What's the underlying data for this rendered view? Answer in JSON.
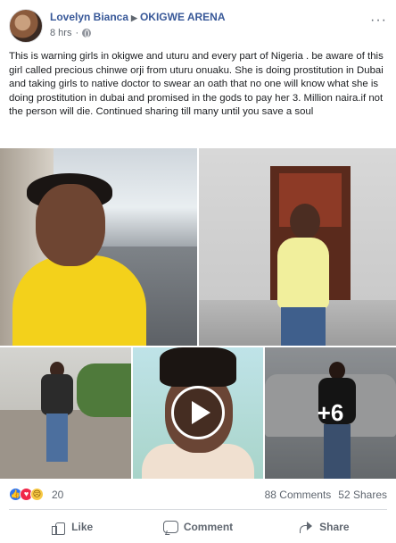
{
  "post": {
    "author": "Lovelyn Bianca",
    "arrow": "▶",
    "group": "OKIGWE ARENA",
    "time": "8 hrs",
    "privacy_separator": "·",
    "privacy_icon": "globe-icon",
    "text": "This is warning girls in okigwe and uturu and every part of Nigeria . be aware of this girl called precious chinwe orji from uturu onuaku. She is doing prostitution in Dubai and taking girls to native doctor to swear an oath that no one will know what she is doing prostitution in dubai and promised in the gods to pay her 3. Million naira.if not the person will die. Continued sharing till many until you save a soul",
    "more_photos": "+6"
  },
  "reactions": {
    "icons": [
      "like-icon",
      "love-icon",
      "sad-icon"
    ],
    "count": "20",
    "comments": "88 Comments",
    "shares": "52 Shares"
  },
  "actions": {
    "like": "Like",
    "comment": "Comment",
    "share": "Share"
  },
  "colors": {
    "link": "#385898",
    "secondary": "#606770",
    "like": "#2f75f0",
    "love": "#f0284a",
    "sad": "#f7c945"
  }
}
